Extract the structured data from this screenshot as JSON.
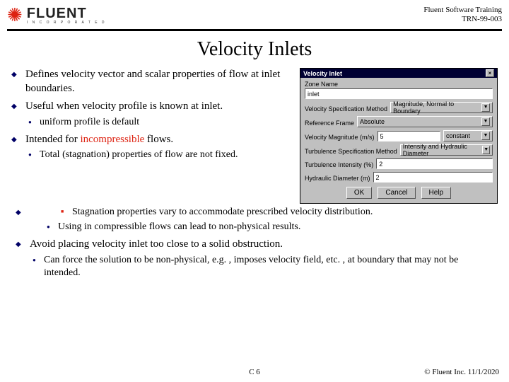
{
  "header": {
    "brand_name": "FLUENT",
    "brand_sub": "I N C O R P O R A T E D",
    "training_line": "Fluent Software Training",
    "doc_id": "TRN-99-003"
  },
  "title": "Velocity Inlets",
  "bullets": {
    "b1": "Defines velocity vector and scalar properties of flow at inlet boundaries.",
    "b2": "Useful when velocity profile is known at inlet.",
    "b2a": "uniform profile is default",
    "b3_pre": "Intended for ",
    "b3_red": "incompressible",
    "b3_post": " flows.",
    "b3a": "Total (stagnation) properties of flow are not fixed.",
    "b3a1": "Stagnation properties vary to accommodate prescribed velocity distribution.",
    "b3b": "Using in compressible flows can lead to non-physical results.",
    "b4": "Avoid placing velocity inlet too close to a solid obstruction.",
    "b4a": "Can force the solution to be non-physical, e.g. , imposes velocity field, etc. , at boundary that may not be intended."
  },
  "dialog": {
    "title": "Velocity Inlet",
    "close": "×",
    "zone_label": "Zone Name",
    "zone_value": "inlet",
    "vsm_label": "Velocity Specification Method",
    "vsm_value": "Magnitude, Normal to Boundary",
    "ref_label": "Reference Frame",
    "ref_value": "Absolute",
    "vmag_label": "Velocity Magnitude (m/s)",
    "vmag_value": "5",
    "vmag_mode": "constant",
    "tsm_label": "Turbulence Specification Method",
    "tsm_value": "Intensity and Hydraulic Diameter",
    "ti_label": "Turbulence Intensity (%)",
    "ti_value": "2",
    "hd_label": "Hydraulic Diameter (m)",
    "hd_value": "2",
    "btn_ok": "OK",
    "btn_cancel": "Cancel",
    "btn_help": "Help"
  },
  "footer": {
    "page": "C 6",
    "copyright": "© Fluent Inc. 11/1/2020"
  }
}
